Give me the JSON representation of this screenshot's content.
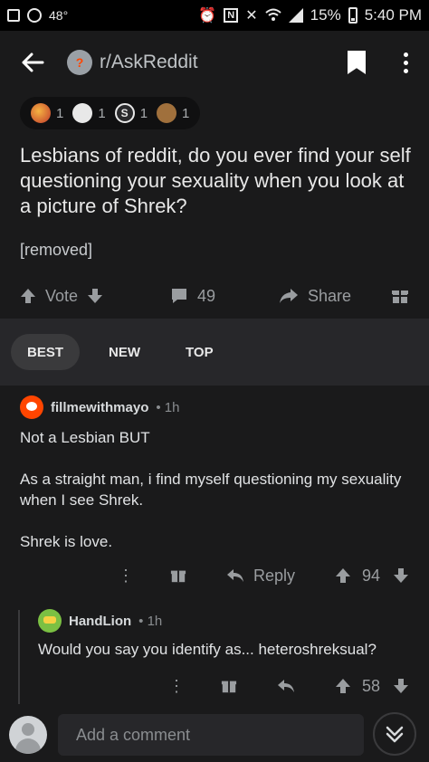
{
  "statusbar": {
    "temp": "48°",
    "battery": "15%",
    "time": "5:40 PM"
  },
  "header": {
    "subreddit": "r/AskReddit"
  },
  "awards": [
    {
      "icon": "rocket-like-award-icon",
      "count": "1",
      "color": "#f5b342"
    },
    {
      "icon": "laughing-face-award-icon",
      "count": "1",
      "color": "#e8e8e8"
    },
    {
      "icon": "s-badge-award-icon",
      "count": "1",
      "color": "#e8e8e8"
    },
    {
      "icon": "sloth-award-icon",
      "count": "1",
      "color": "#a0703c"
    }
  ],
  "post": {
    "title": "Lesbians of reddit, do you ever find your self questioning your sexuality when you look at a picture of Shrek?",
    "body": "[removed]",
    "vote_label": "Vote",
    "comment_count": "49",
    "share_label": "Share"
  },
  "sort": {
    "tabs": [
      "BEST",
      "NEW",
      "TOP"
    ],
    "active": "BEST"
  },
  "comments": [
    {
      "user": "fillmewithmayo",
      "time": "• 1h",
      "body": "Not a Lesbian BUT\n\nAs a straight man, i find myself questioning my sexuality when I see Shrek.\n\nShrek is love.",
      "reply_label": "Reply",
      "score": "94",
      "avatar_color": "#ff4500"
    },
    {
      "user": "HandLion",
      "time": "• 1h",
      "body": "Would you say you identify as... heteroshreksual?",
      "score": "58",
      "avatar_color": "#7bc043"
    }
  ],
  "composer": {
    "placeholder": "Add a comment"
  },
  "colors": {
    "background": "#1a1a1b",
    "sortbar": "#27272a",
    "text": "#d7dadc",
    "muted": "#9a9da0"
  }
}
